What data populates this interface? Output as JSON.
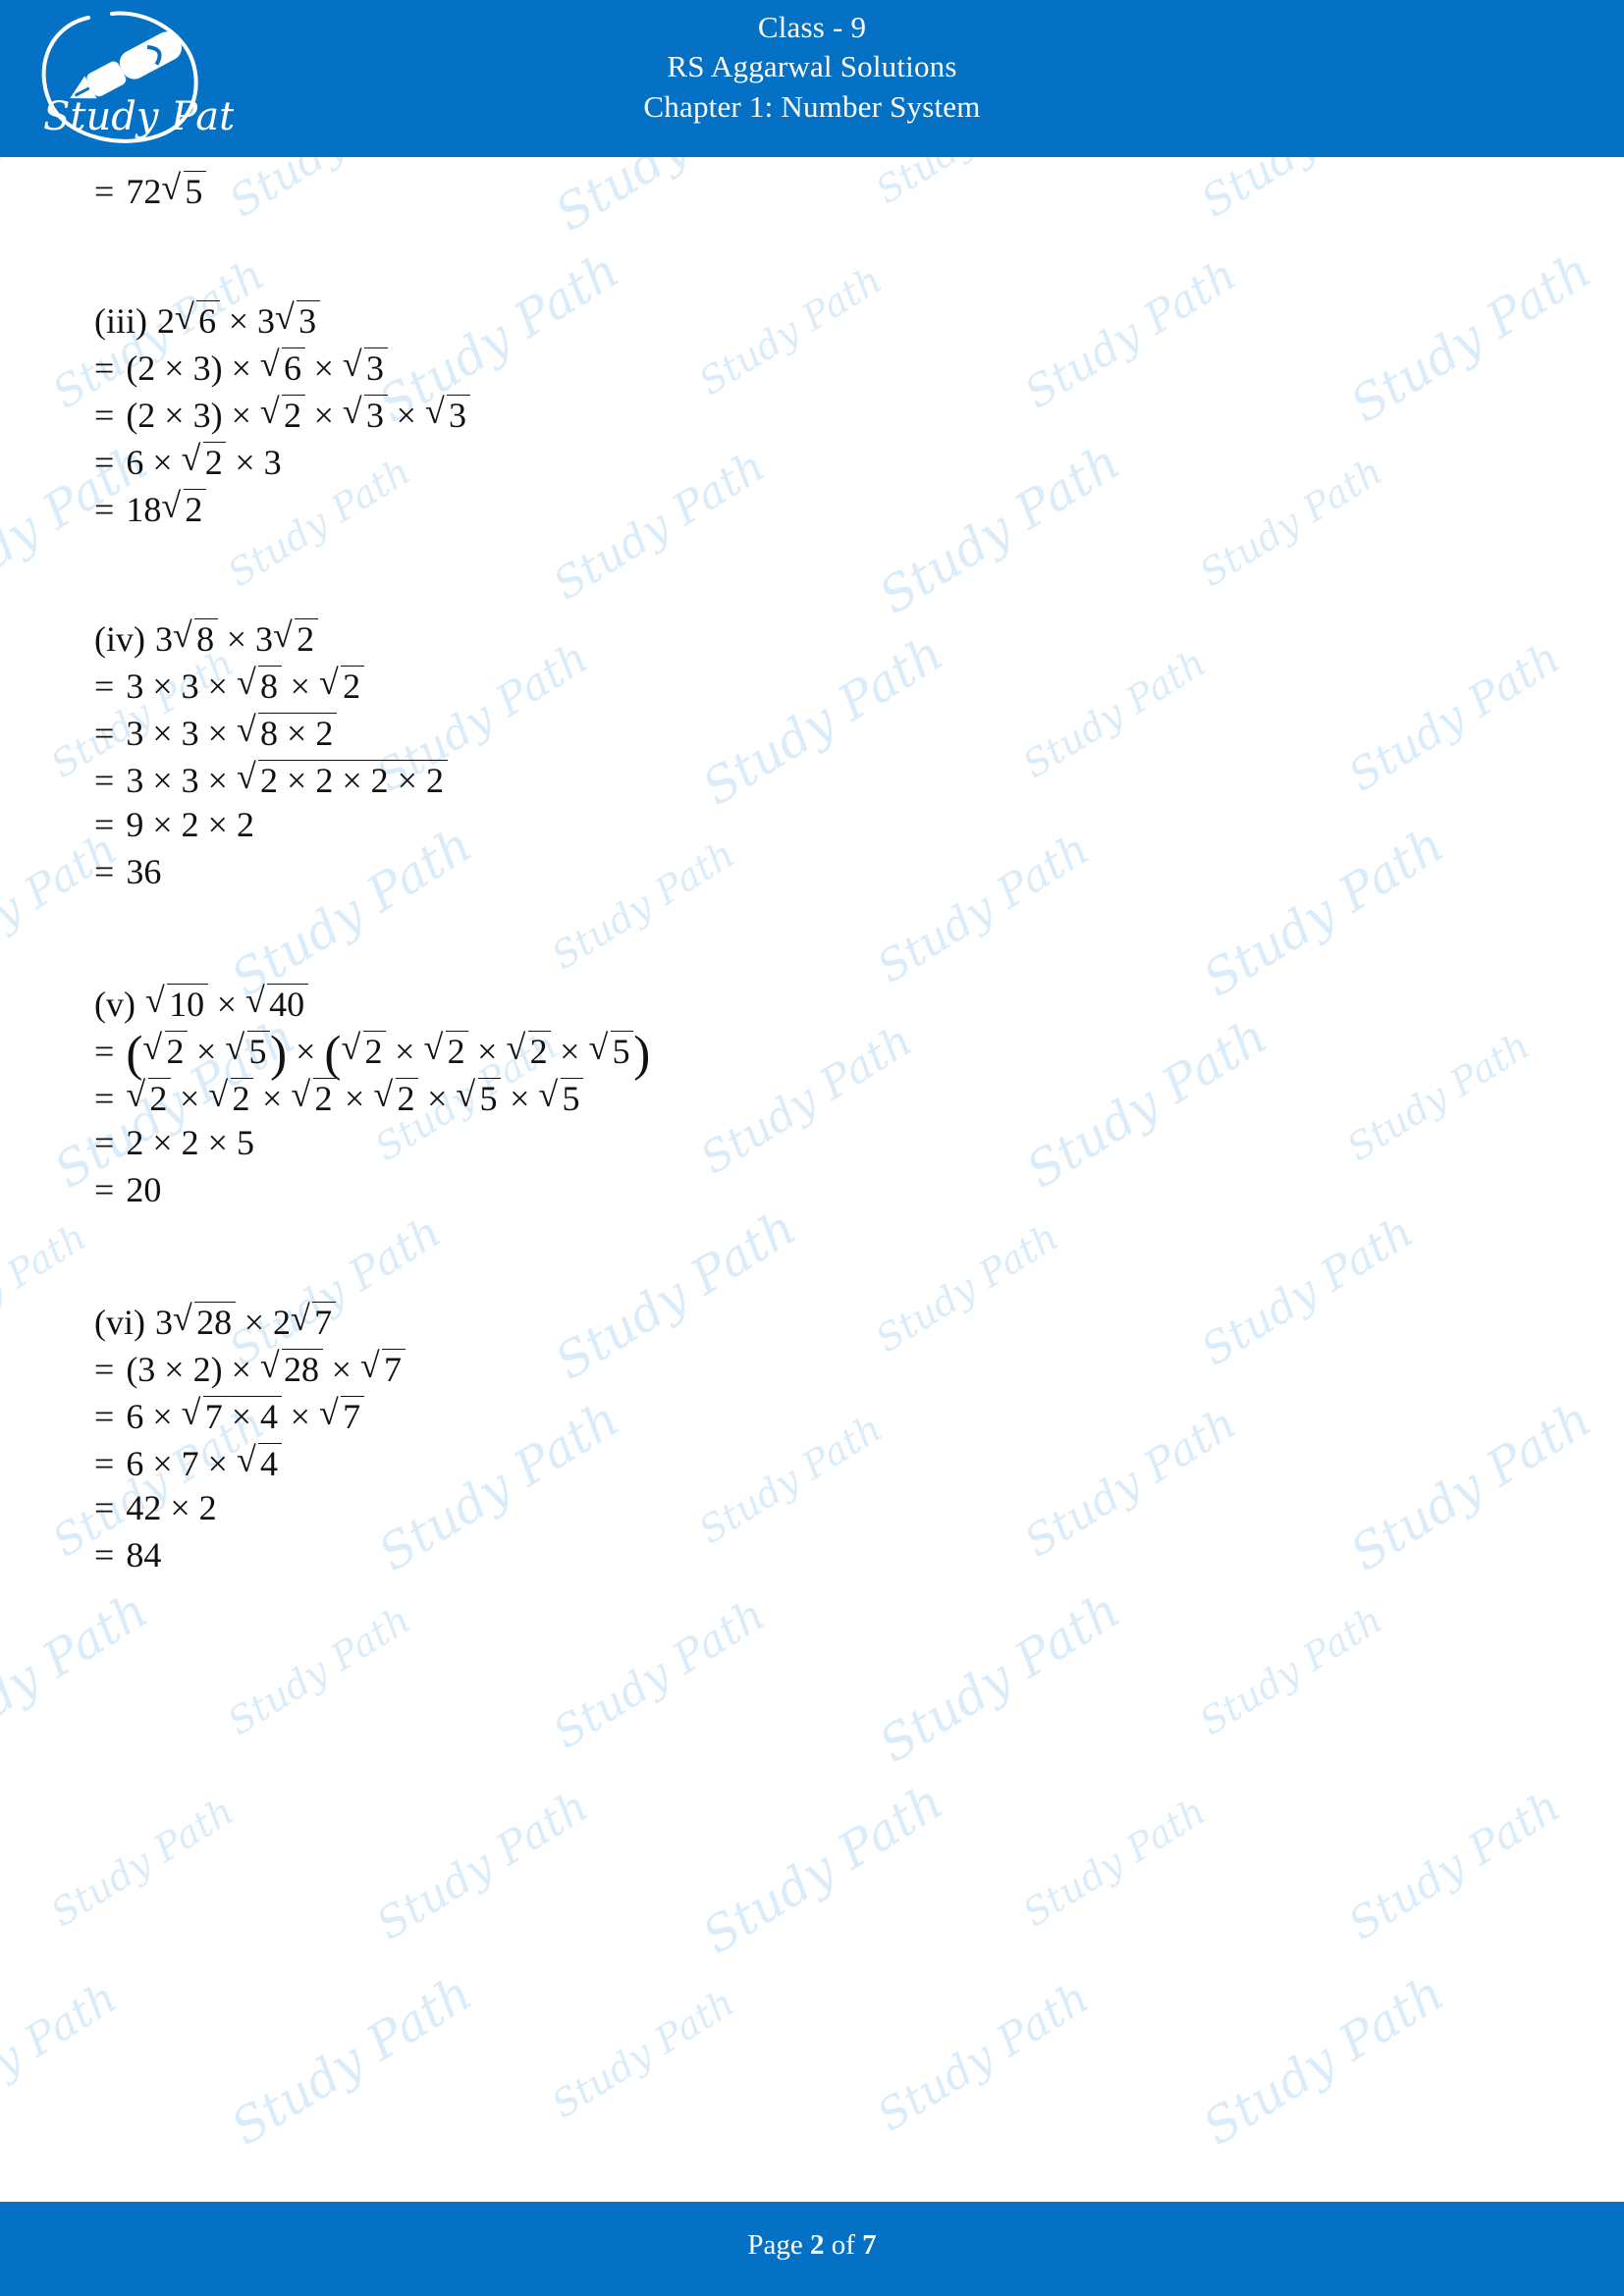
{
  "header": {
    "line1": "Class - 9",
    "line2": "RS Aggarwal Solutions",
    "line3": "Chapter 1: Number System",
    "logo_text": "Study Path",
    "logo_icon": "pen-nib-icon",
    "background_color": "#0571c4"
  },
  "footer": {
    "prefix": "Page",
    "current_page": "2",
    "middle": "of",
    "total_pages": "7",
    "background_color": "#0571c4"
  },
  "watermark": {
    "text": "Study Path",
    "color": "#d9ecfa"
  },
  "solution": {
    "blocks": [
      {
        "id": "block-continued",
        "label": "",
        "lines": [
          {
            "eq": "=",
            "expr": "72√5",
            "parts": [
              {
                "t": "txt",
                "v": "72"
              },
              {
                "t": "sqrt",
                "v": "5"
              }
            ]
          }
        ]
      },
      {
        "id": "block-iii",
        "label": "(iii)",
        "lines": [
          {
            "eq": "",
            "expr": "(iii) 2√6 × 3√3",
            "parts": [
              {
                "t": "label",
                "v": "(iii)"
              },
              {
                "t": "txt",
                "v": "2"
              },
              {
                "t": "sqrt",
                "v": "6"
              },
              {
                "t": "op",
                "v": "×"
              },
              {
                "t": "txt",
                "v": "3"
              },
              {
                "t": "sqrt",
                "v": "3"
              }
            ]
          },
          {
            "eq": "=",
            "expr": "= (2 × 3) × √6 × √3",
            "parts": [
              {
                "t": "txt",
                "v": "(2 × 3)"
              },
              {
                "t": "op",
                "v": "×"
              },
              {
                "t": "sqrt",
                "v": "6"
              },
              {
                "t": "op",
                "v": "×"
              },
              {
                "t": "sqrt",
                "v": "3"
              }
            ]
          },
          {
            "eq": "=",
            "expr": "= (2 × 3) × √2 × √3 × √3",
            "parts": [
              {
                "t": "txt",
                "v": "(2 × 3)"
              },
              {
                "t": "op",
                "v": "×"
              },
              {
                "t": "sqrt",
                "v": "2"
              },
              {
                "t": "op",
                "v": "×"
              },
              {
                "t": "sqrt",
                "v": "3"
              },
              {
                "t": "op",
                "v": "×"
              },
              {
                "t": "sqrt",
                "v": "3"
              }
            ]
          },
          {
            "eq": "=",
            "expr": "= 6 × √2 × 3",
            "parts": [
              {
                "t": "txt",
                "v": "6"
              },
              {
                "t": "op",
                "v": "×"
              },
              {
                "t": "sqrt",
                "v": "2"
              },
              {
                "t": "op",
                "v": "×"
              },
              {
                "t": "txt",
                "v": "3"
              }
            ]
          },
          {
            "eq": "=",
            "expr": "= 18√2",
            "parts": [
              {
                "t": "txt",
                "v": "18"
              },
              {
                "t": "sqrt",
                "v": "2"
              }
            ]
          }
        ]
      },
      {
        "id": "block-iv",
        "label": "(iv)",
        "lines": [
          {
            "eq": "",
            "expr": "(iv) 3√8 × 3√2",
            "parts": [
              {
                "t": "label",
                "v": "(iv)"
              },
              {
                "t": "txt",
                "v": "3"
              },
              {
                "t": "sqrt",
                "v": "8"
              },
              {
                "t": "op",
                "v": "×"
              },
              {
                "t": "txt",
                "v": "3"
              },
              {
                "t": "sqrt",
                "v": "2"
              }
            ]
          },
          {
            "eq": "=",
            "expr": "= 3 × 3 × √8 × √2",
            "parts": [
              {
                "t": "txt",
                "v": "3"
              },
              {
                "t": "op",
                "v": "×"
              },
              {
                "t": "txt",
                "v": "3"
              },
              {
                "t": "op",
                "v": "×"
              },
              {
                "t": "sqrt",
                "v": "8"
              },
              {
                "t": "op",
                "v": "×"
              },
              {
                "t": "sqrt",
                "v": "2"
              }
            ]
          },
          {
            "eq": "=",
            "expr": "= 3 × 3 × √(8 × 2)",
            "parts": [
              {
                "t": "txt",
                "v": "3"
              },
              {
                "t": "op",
                "v": "×"
              },
              {
                "t": "txt",
                "v": "3"
              },
              {
                "t": "op",
                "v": "×"
              },
              {
                "t": "sqrt",
                "v": "8 × 2"
              }
            ]
          },
          {
            "eq": "=",
            "expr": "= 3 × 3 × √(2 × 2 × 2 × 2)",
            "parts": [
              {
                "t": "txt",
                "v": "3"
              },
              {
                "t": "op",
                "v": "×"
              },
              {
                "t": "txt",
                "v": "3"
              },
              {
                "t": "op",
                "v": "×"
              },
              {
                "t": "sqrt",
                "v": "2 × 2 × 2 × 2"
              }
            ]
          },
          {
            "eq": "=",
            "expr": "= 9 × 2 × 2",
            "parts": [
              {
                "t": "txt",
                "v": "9"
              },
              {
                "t": "op",
                "v": "×"
              },
              {
                "t": "txt",
                "v": "2"
              },
              {
                "t": "op",
                "v": "×"
              },
              {
                "t": "txt",
                "v": "2"
              }
            ]
          },
          {
            "eq": "=",
            "expr": "= 36",
            "parts": [
              {
                "t": "txt",
                "v": "36"
              }
            ]
          }
        ]
      },
      {
        "id": "block-v",
        "label": "(v)",
        "lines": [
          {
            "eq": "",
            "expr": "(v) √10 × √40",
            "parts": [
              {
                "t": "label",
                "v": "(v)"
              },
              {
                "t": "sqrt",
                "v": "10"
              },
              {
                "t": "op",
                "v": "×"
              },
              {
                "t": "sqrt",
                "v": "40"
              }
            ]
          },
          {
            "eq": "=",
            "expr": "= (√2 × √5) × (√2 × √2 × √2 × √5)",
            "parts": [
              {
                "t": "bparen",
                "v": "("
              },
              {
                "t": "sqrt",
                "v": "2"
              },
              {
                "t": "op",
                "v": "×"
              },
              {
                "t": "sqrt",
                "v": "5"
              },
              {
                "t": "bparen",
                "v": ")"
              },
              {
                "t": "op",
                "v": "×"
              },
              {
                "t": "bparen",
                "v": "("
              },
              {
                "t": "sqrt",
                "v": "2"
              },
              {
                "t": "op",
                "v": "×"
              },
              {
                "t": "sqrt",
                "v": "2"
              },
              {
                "t": "op",
                "v": "×"
              },
              {
                "t": "sqrt",
                "v": "2"
              },
              {
                "t": "op",
                "v": "×"
              },
              {
                "t": "sqrt",
                "v": "5"
              },
              {
                "t": "bparen",
                "v": ")"
              }
            ]
          },
          {
            "eq": "=",
            "expr": "= √2 × √2 × √2 × √2 × √5 × √5",
            "parts": [
              {
                "t": "sqrt",
                "v": "2"
              },
              {
                "t": "op",
                "v": "×"
              },
              {
                "t": "sqrt",
                "v": "2"
              },
              {
                "t": "op",
                "v": "×"
              },
              {
                "t": "sqrt",
                "v": "2"
              },
              {
                "t": "op",
                "v": "×"
              },
              {
                "t": "sqrt",
                "v": "2"
              },
              {
                "t": "op",
                "v": "×"
              },
              {
                "t": "sqrt",
                "v": "5"
              },
              {
                "t": "op",
                "v": "×"
              },
              {
                "t": "sqrt",
                "v": "5"
              }
            ]
          },
          {
            "eq": "=",
            "expr": "= 2 × 2 × 5",
            "parts": [
              {
                "t": "txt",
                "v": "2"
              },
              {
                "t": "op",
                "v": "×"
              },
              {
                "t": "txt",
                "v": "2"
              },
              {
                "t": "op",
                "v": "×"
              },
              {
                "t": "txt",
                "v": "5"
              }
            ]
          },
          {
            "eq": "=",
            "expr": "= 20",
            "parts": [
              {
                "t": "txt",
                "v": "20"
              }
            ]
          }
        ]
      },
      {
        "id": "block-vi",
        "label": "(vi)",
        "lines": [
          {
            "eq": "",
            "expr": "(vi) 3√28 × 2√7",
            "parts": [
              {
                "t": "label",
                "v": "(vi)"
              },
              {
                "t": "txt",
                "v": "3"
              },
              {
                "t": "sqrt",
                "v": "28"
              },
              {
                "t": "op",
                "v": "×"
              },
              {
                "t": "txt",
                "v": "2"
              },
              {
                "t": "sqrt",
                "v": "7"
              }
            ]
          },
          {
            "eq": "=",
            "expr": "= (3 × 2) × √28 × √7",
            "parts": [
              {
                "t": "txt",
                "v": "(3 × 2)"
              },
              {
                "t": "op",
                "v": "×"
              },
              {
                "t": "sqrt",
                "v": "28"
              },
              {
                "t": "op",
                "v": "×"
              },
              {
                "t": "sqrt",
                "v": "7"
              }
            ]
          },
          {
            "eq": "=",
            "expr": "= 6 × √(7 × 4) × √7",
            "parts": [
              {
                "t": "txt",
                "v": "6"
              },
              {
                "t": "op",
                "v": "×"
              },
              {
                "t": "sqrt",
                "v": "7 × 4"
              },
              {
                "t": "op",
                "v": "×"
              },
              {
                "t": "sqrt",
                "v": "7"
              }
            ]
          },
          {
            "eq": "=",
            "expr": "= 6 × 7 × √4",
            "parts": [
              {
                "t": "txt",
                "v": "6"
              },
              {
                "t": "op",
                "v": "×"
              },
              {
                "t": "txt",
                "v": "7"
              },
              {
                "t": "op",
                "v": "×"
              },
              {
                "t": "sqrt",
                "v": "4"
              }
            ]
          },
          {
            "eq": "=",
            "expr": "= 42 × 2",
            "parts": [
              {
                "t": "txt",
                "v": "42"
              },
              {
                "t": "op",
                "v": "×"
              },
              {
                "t": "txt",
                "v": "2"
              }
            ]
          },
          {
            "eq": "=",
            "expr": "= 84",
            "parts": [
              {
                "t": "txt",
                "v": "84"
              }
            ]
          }
        ]
      }
    ]
  }
}
